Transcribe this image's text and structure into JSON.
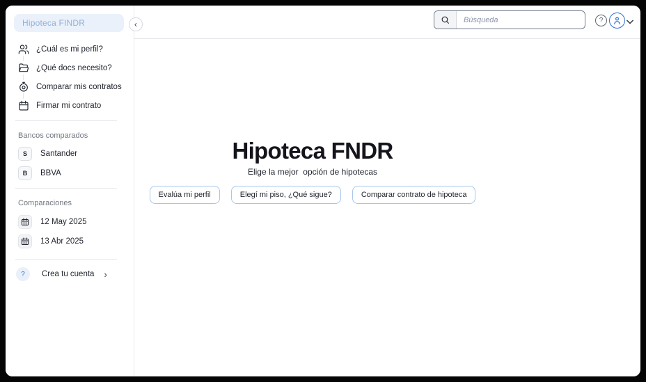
{
  "sidebar": {
    "brand": "Hipoteca FINDR",
    "collapse_icon": "‹",
    "nav": [
      {
        "icon": "users-icon",
        "label": "¿Cuál es mi perfil?"
      },
      {
        "icon": "folder-icon",
        "label": "¿Qué docs necesito?"
      },
      {
        "icon": "stopwatch-icon",
        "label": "Comparar mis contratos"
      },
      {
        "icon": "calendar-icon",
        "label": "Firmar mi contrato"
      }
    ],
    "banks": {
      "label": "Bancos comparados",
      "items": [
        {
          "initial": "S",
          "name": "Santander"
        },
        {
          "initial": "B",
          "name": "BBVA"
        }
      ]
    },
    "comparisons": {
      "label": "Comparaciones",
      "items": [
        {
          "icon": "calendar-date-icon",
          "date": "12 May 2025"
        },
        {
          "icon": "calendar-date-icon",
          "date": "13 Abr 2025"
        }
      ]
    },
    "footer": {
      "badge": "?",
      "label": "Crea tu cuenta",
      "chevron": "›"
    }
  },
  "topbar": {
    "search": {
      "icon": "magnifier-icon",
      "placeholder": "Búsqueda"
    },
    "help_glyph": "?"
  },
  "main": {
    "title": "Hipoteca FNDR",
    "subtitle": "Elige la mejor  opción de hipotecas",
    "actions": [
      {
        "label": "Evalúa mi perfil"
      },
      {
        "label": "Elegí mi piso, ¿Qué sigue?"
      },
      {
        "label": "Comparar contrato de hipoteca"
      }
    ]
  },
  "colors": {
    "accent_blue": "#2f6fd6",
    "brand_box_bg": "#eaf1fa",
    "brand_text": "#92b0d4",
    "button_border": "#a7c7e9",
    "divider": "#e7e8ec",
    "text_dark": "#20232c",
    "text_muted": "#70767f",
    "frame": "#000000"
  }
}
